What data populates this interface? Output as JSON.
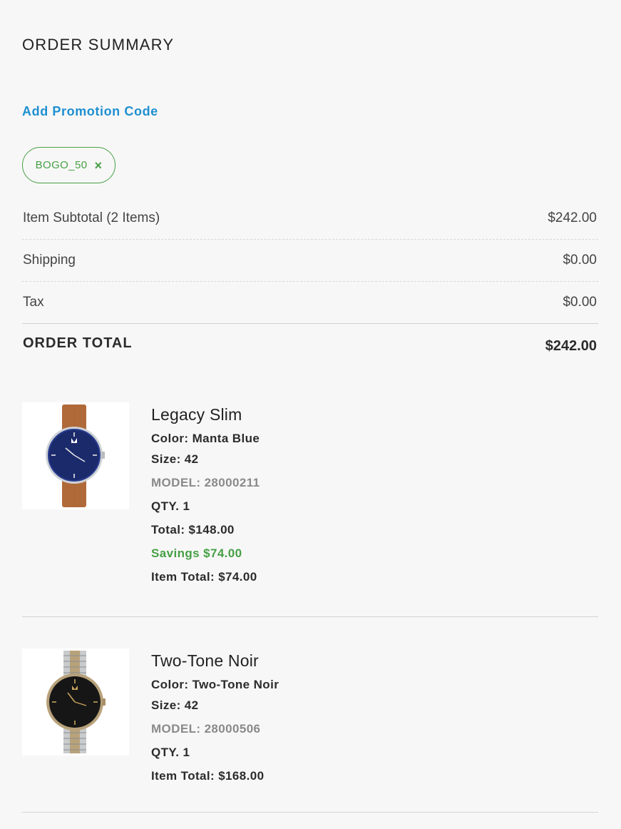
{
  "summary": {
    "title": "ORDER SUMMARY",
    "promo_link": "Add Promotion Code",
    "promo_chip": {
      "code": "BOGO_50",
      "remove_icon": "×"
    },
    "rows": [
      {
        "label": "Item Subtotal (2 Items)",
        "value": "$242.00"
      },
      {
        "label": "Shipping",
        "value": "$0.00"
      },
      {
        "label": "Tax",
        "value": "$0.00"
      }
    ],
    "total": {
      "label": "ORDER TOTAL",
      "value": "$242.00"
    }
  },
  "items": [
    {
      "name": "Legacy Slim",
      "color": "Color: Manta Blue",
      "size": "Size: 42",
      "model": "MODEL: 28000211",
      "qty": "QTY. 1",
      "total": "Total: $148.00",
      "savings": "Savings $74.00",
      "item_total": "Item Total: $74.00",
      "image": "watch-blue-dial-brown-strap"
    },
    {
      "name": "Two-Tone Noir",
      "color": "Color: Two-Tone Noir",
      "size": "Size: 42",
      "model": "MODEL: 28000506",
      "qty": "QTY. 1",
      "item_total": "Item Total: $168.00",
      "image": "watch-black-dial-two-tone-bracelet"
    }
  ],
  "colors": {
    "accent_link": "#1d8fd1",
    "success": "#46a046",
    "muted": "#8a8a8a"
  }
}
